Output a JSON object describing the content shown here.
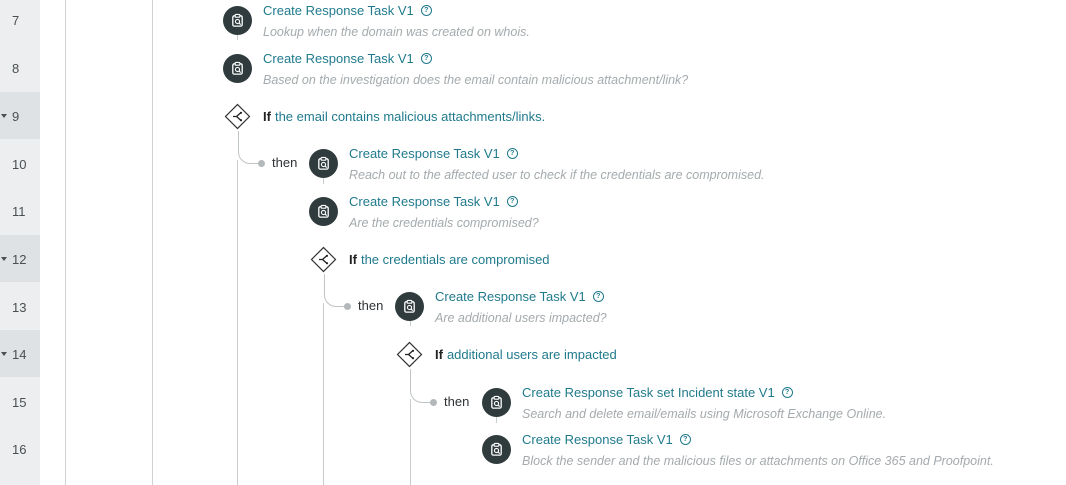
{
  "gutter": {
    "lines": [
      {
        "num": "7"
      },
      {
        "num": "8"
      },
      {
        "num": "9",
        "fold": true
      },
      {
        "num": "10"
      },
      {
        "num": "11"
      },
      {
        "num": "12",
        "fold": true
      },
      {
        "num": "13"
      },
      {
        "num": "14",
        "fold": true
      },
      {
        "num": "15"
      },
      {
        "num": "16"
      }
    ]
  },
  "flow": {
    "then_label": "then",
    "if_keyword": "If",
    "steps": [
      {
        "title": "Create Response Task V1",
        "desc": "Lookup when the domain was created on whois."
      },
      {
        "title": "Create Response Task V1",
        "desc": "Based on the investigation does the email contain malicious attachment/link?"
      },
      {
        "condition": "the email contains malicious attachments/links."
      },
      {
        "title": "Create Response Task V1",
        "desc": "Reach out to the affected user to check if the credentials are compromised."
      },
      {
        "title": "Create Response Task V1",
        "desc": "Are the credentials compromised?"
      },
      {
        "condition": "the credentials are compromised"
      },
      {
        "title": "Create Response Task V1",
        "desc": "Are additional users impacted?"
      },
      {
        "condition": "additional users are impacted"
      },
      {
        "title": "Create Response Task set Incident state V1",
        "desc": "Search and delete email/emails using Microsoft Exchange Online."
      },
      {
        "title": "Create Response Task V1",
        "desc": "Block the sender and the malicious files or attachments on Office 365 and Proofpoint."
      }
    ]
  },
  "icons": {
    "task": "clipboard-task-icon",
    "condition": "branch-diamond-icon",
    "help": "help-circle-icon"
  }
}
